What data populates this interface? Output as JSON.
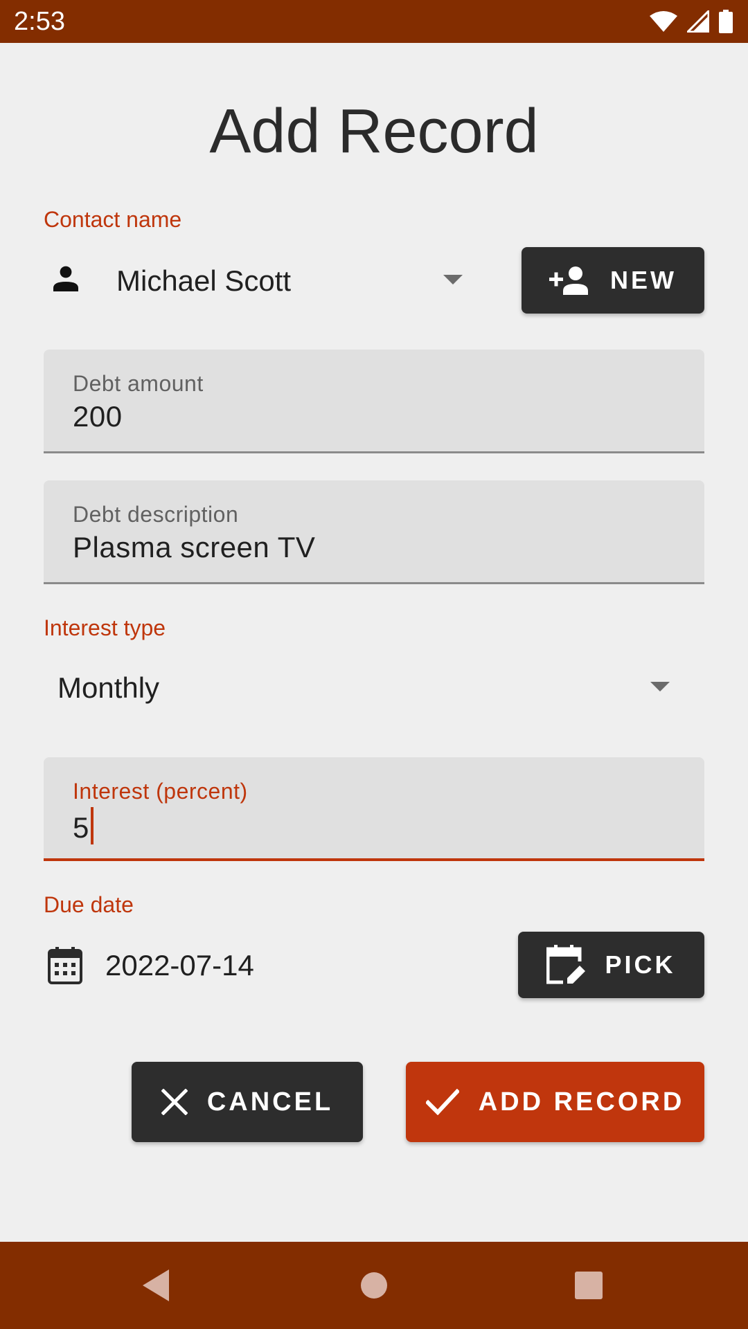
{
  "status_bar": {
    "time": "2:53",
    "icons": [
      "wifi-icon",
      "cell-signal-icon",
      "battery-icon"
    ]
  },
  "page": {
    "title": "Add Record"
  },
  "contact": {
    "label": "Contact name",
    "selected": "Michael Scott",
    "icon": "person-icon",
    "new_button": {
      "label": "NEW",
      "icon": "person-add-icon"
    }
  },
  "debt_amount": {
    "label": "Debt amount",
    "value": "200"
  },
  "debt_description": {
    "label": "Debt description",
    "value": "Plasma screen TV"
  },
  "interest_type": {
    "label": "Interest type",
    "selected": "Monthly"
  },
  "interest_percent": {
    "label": "Interest (percent)",
    "value": "5",
    "focused": true
  },
  "due_date": {
    "label": "Due date",
    "value": "2022-07-14",
    "icon": "calendar-icon",
    "pick_button": {
      "label": "PICK",
      "icon": "edit-calendar-icon"
    }
  },
  "actions": {
    "cancel_label": "CANCEL",
    "cancel_icon": "close-icon",
    "add_label": "ADD RECORD",
    "add_icon": "check-icon"
  },
  "nav_bar": {
    "buttons": [
      "back-icon",
      "home-icon",
      "recents-icon"
    ]
  },
  "colors": {
    "primary_dark": "#832d00",
    "accent": "#c0360d",
    "label_accent": "#bf360c",
    "button_dark": "#2d2d2d",
    "background": "#efefef",
    "field_background": "#e0e0e0"
  }
}
